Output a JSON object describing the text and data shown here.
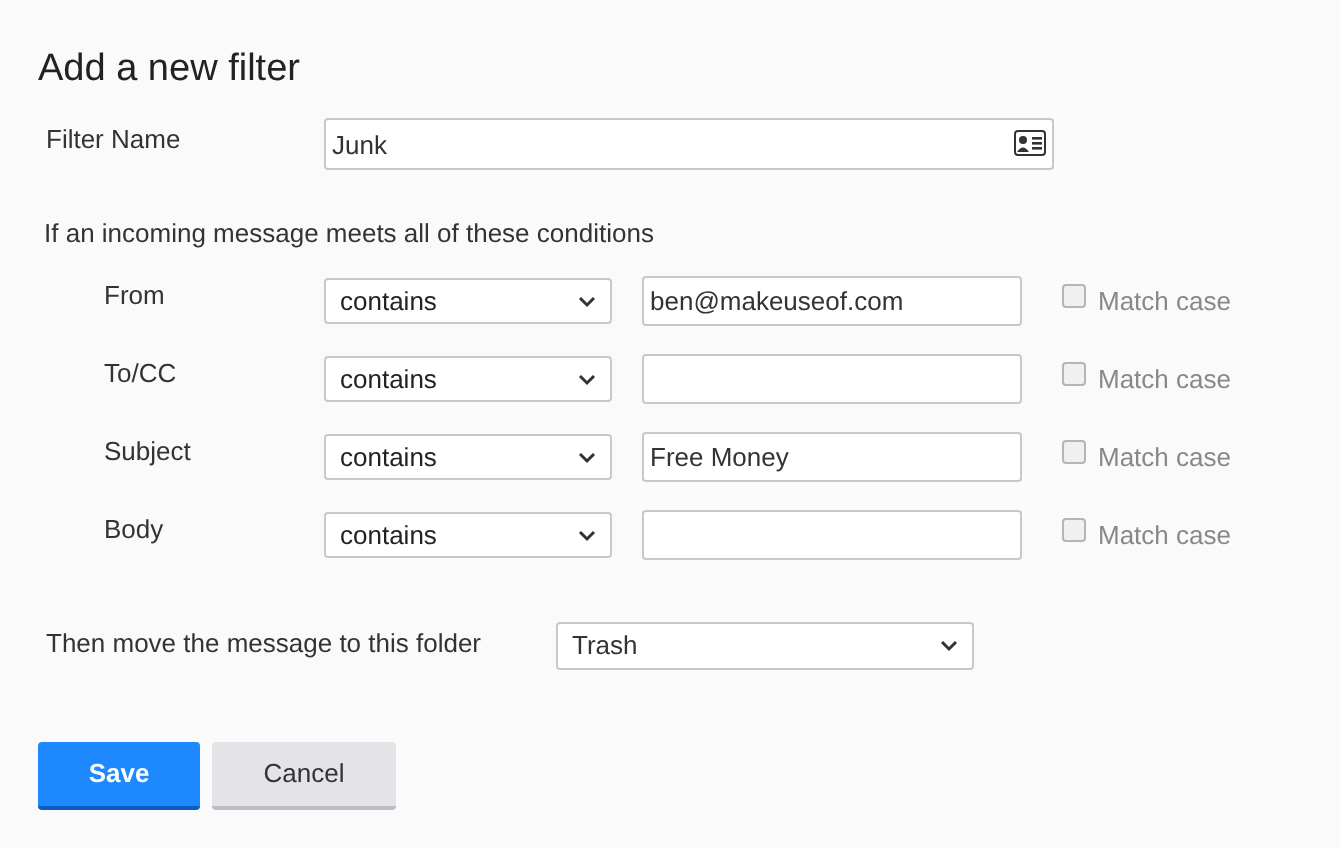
{
  "title": "Add a new filter",
  "filter_name": {
    "label": "Filter Name",
    "value": "Junk"
  },
  "conditions_intro": "If an incoming message meets all of these conditions",
  "conditions": [
    {
      "field": "From",
      "operator": "contains",
      "value": "ben@makeuseof.com",
      "match_case": {
        "label": "Match case",
        "checked": false
      }
    },
    {
      "field": "To/CC",
      "operator": "contains",
      "match_case": {
        "label": "Match case",
        "checked": false
      }
    },
    {
      "field": "Subject",
      "operator": "contains",
      "value": "Free Money",
      "match_case": {
        "label": "Match case",
        "checked": false
      }
    },
    {
      "field": "Body",
      "operator": "contains",
      "match_case": {
        "label": "Match case",
        "checked": false
      }
    }
  ],
  "action": {
    "label": "Then move the message to this folder",
    "folder": "Trash"
  },
  "buttons": [
    {
      "label": "Save",
      "kind": "primary"
    },
    {
      "label": "Cancel",
      "kind": "secondary"
    }
  ]
}
